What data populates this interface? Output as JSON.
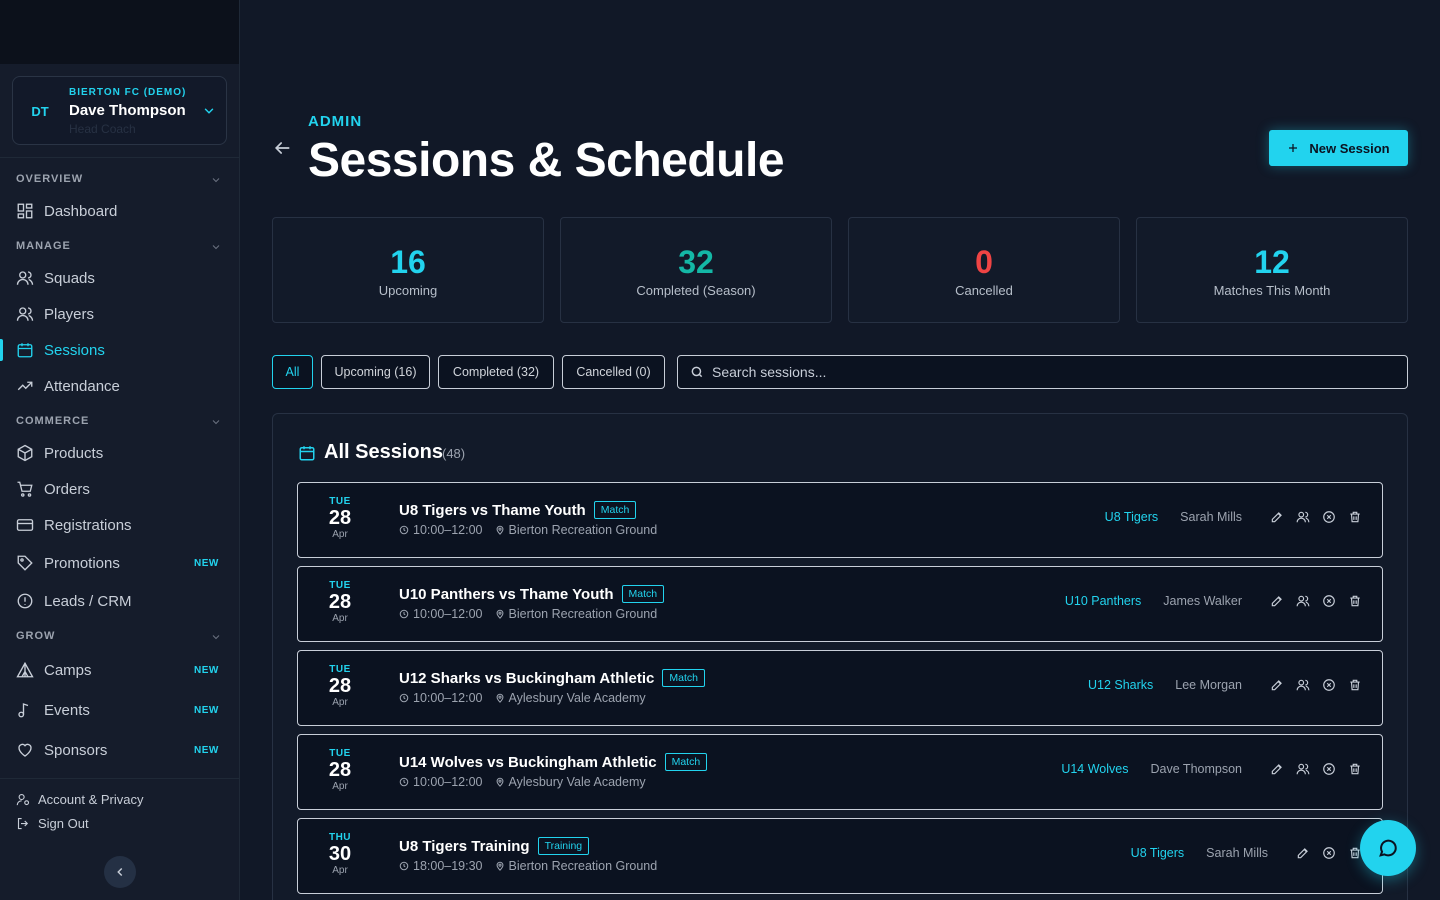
{
  "org": {
    "name": "BIERTON FC (DEMO)",
    "initials": "DT",
    "user": "Dave Thompson",
    "role": "Head Coach"
  },
  "sidebar": {
    "sections": {
      "overview": "OVERVIEW",
      "manage": "MANAGE",
      "commerce": "COMMERCE",
      "grow": "GROW"
    },
    "items": {
      "dashboard": "Dashboard",
      "squads": "Squads",
      "players": "Players",
      "sessions": "Sessions",
      "attendance": "Attendance",
      "products": "Products",
      "orders": "Orders",
      "registrations": "Registrations",
      "promotions": "Promotions",
      "leads": "Leads / CRM",
      "camps": "Camps",
      "events": "Events",
      "sponsors": "Sponsors"
    },
    "new_badge": "NEW",
    "active": "sessions",
    "footer": {
      "account": "Account & Privacy",
      "signout": "Sign Out"
    }
  },
  "header": {
    "eyebrow": "ADMIN",
    "title": "Sessions & Schedule",
    "new_button": "New Session"
  },
  "stats": [
    {
      "value": "16",
      "label": "Upcoming",
      "color": "#22d3ee"
    },
    {
      "value": "32",
      "label": "Completed (Season)",
      "color": "#14b8a6"
    },
    {
      "value": "0",
      "label": "Cancelled",
      "color": "#ef4444"
    },
    {
      "value": "12",
      "label": "Matches This Month",
      "color": "#22d3ee"
    }
  ],
  "filters": [
    "All",
    "Upcoming (16)",
    "Completed (32)",
    "Cancelled (0)"
  ],
  "search": {
    "placeholder": "Search sessions..."
  },
  "panel": {
    "title": "All Sessions",
    "count": "(48)"
  },
  "sessions": [
    {
      "dow": "TUE",
      "day": "28",
      "month": "Apr",
      "title": "U8 Tigers vs Thame Youth",
      "type": "Match",
      "time": "10:00–12:00",
      "venue": "Bierton Recreation Ground",
      "squad": "U8 Tigers",
      "coach": "Sarah Mills"
    },
    {
      "dow": "TUE",
      "day": "28",
      "month": "Apr",
      "title": "U10 Panthers vs Thame Youth",
      "type": "Match",
      "time": "10:00–12:00",
      "venue": "Bierton Recreation Ground",
      "squad": "U10 Panthers",
      "coach": "James Walker"
    },
    {
      "dow": "TUE",
      "day": "28",
      "month": "Apr",
      "title": "U12 Sharks vs Buckingham Athletic",
      "type": "Match",
      "time": "10:00–12:00",
      "venue": "Aylesbury Vale Academy",
      "squad": "U12 Sharks",
      "coach": "Lee Morgan"
    },
    {
      "dow": "TUE",
      "day": "28",
      "month": "Apr",
      "title": "U14 Wolves vs Buckingham Athletic",
      "type": "Match",
      "time": "10:00–12:00",
      "venue": "Aylesbury Vale Academy",
      "squad": "U14 Wolves",
      "coach": "Dave Thompson"
    },
    {
      "dow": "THU",
      "day": "30",
      "month": "Apr",
      "title": "U8 Tigers Training",
      "type": "Training",
      "time": "18:00–19:30",
      "venue": "Bierton Recreation Ground",
      "squad": "U8 Tigers",
      "coach": "Sarah Mills"
    }
  ],
  "colors": {
    "accent": "#22d3ee",
    "background": "#111827",
    "sidebar": "#151c2b"
  }
}
